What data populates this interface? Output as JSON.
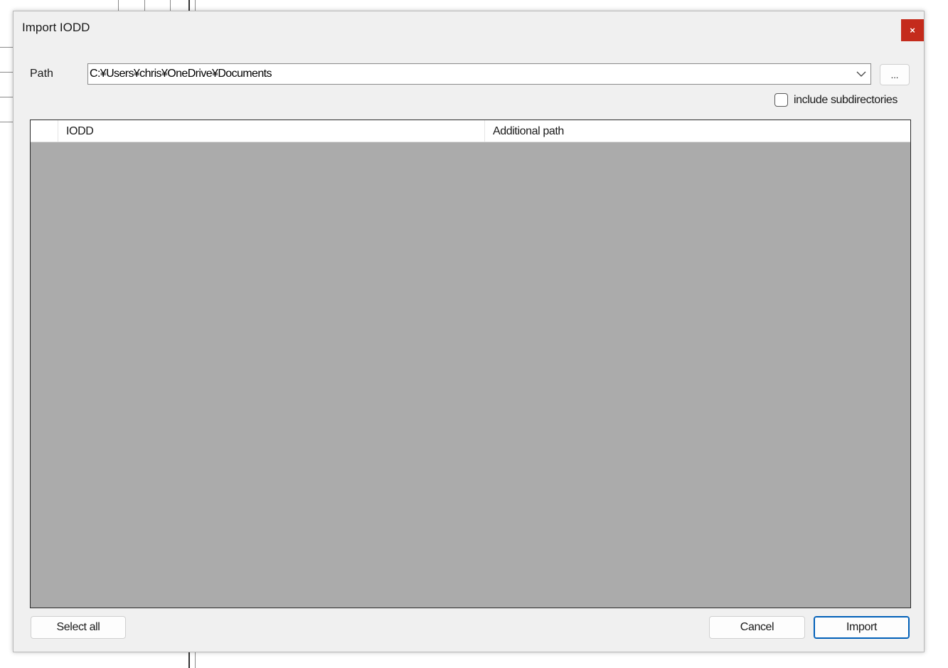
{
  "window": {
    "title": "Import IODD",
    "close_symbol": "×"
  },
  "path": {
    "label": "Path",
    "value": "C:¥Users¥chris¥OneDrive¥Documents",
    "browse_label": "..."
  },
  "options": {
    "include_subdirectories_label": "include subdirectories",
    "include_subdirectories_checked": false
  },
  "grid": {
    "columns": [
      "",
      "IODD",
      "Additional path"
    ],
    "rows": []
  },
  "buttons": {
    "select_all": "Select all",
    "cancel": "Cancel",
    "import": "Import"
  },
  "colors": {
    "close_button": "#c42b1c",
    "grid_background": "#ababab",
    "default_button_border": "#005fb8"
  }
}
